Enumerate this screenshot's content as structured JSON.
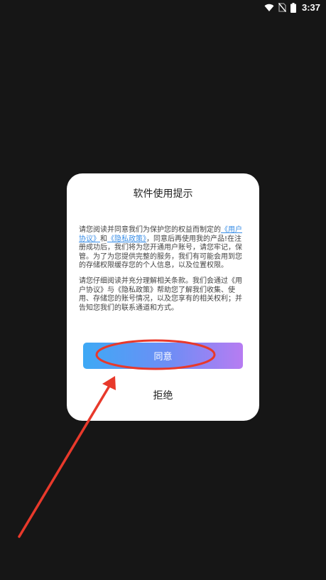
{
  "status_bar": {
    "time": "3:37",
    "icons": [
      "wifi-icon",
      "no-sim-icon",
      "battery-icon"
    ]
  },
  "dialog": {
    "title": "软件使用提示",
    "para1_prefix": "请您阅读并同意我们为保护您的权益而制定的",
    "user_agreement_link": "《用户协议》",
    "and": "和",
    "privacy_policy_link": "《隐私政策》",
    "para1_suffix": "，同意后再使用我的产品!在注册成功后，我们将为您开通用户账号，请您牢记，保管。为了为您提供完整的服务，我们有可能会用到您的存储权限缓存您的个人信息，以及位置权限。",
    "para2": "请您仔细阅读并充分理解相关条款。我们会通过《用户协议》与《隐私政策》帮助您了解我们收集、使用、存储您的账号情况，以及您享有的相关权利；并告知您我们的联系通道和方式。",
    "agree_label": "同意",
    "reject_label": "拒绝"
  },
  "colors": {
    "background": "#161616",
    "dialog": "#ffffff",
    "link": "#3a8ee6",
    "gradient_start": "#3ea9f5",
    "gradient_end": "#b77cf2",
    "annotation": "#e8392b"
  }
}
